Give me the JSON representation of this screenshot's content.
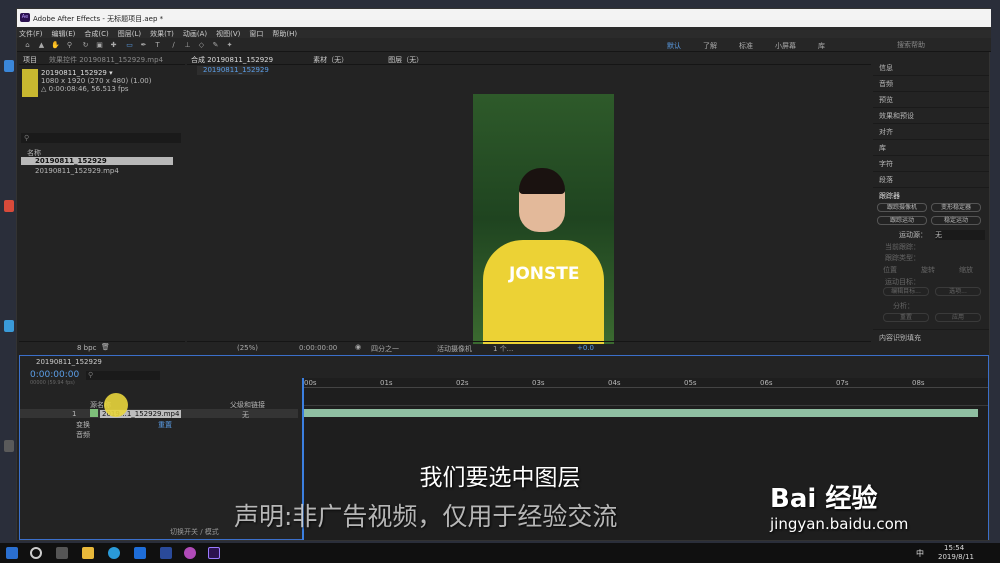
{
  "app": {
    "title": "Adobe After Effects - 无标题项目.aep *",
    "logo": "Ae"
  },
  "menu": [
    "文件(F)",
    "编辑(E)",
    "合成(C)",
    "图层(L)",
    "效果(T)",
    "动画(A)",
    "视图(V)",
    "窗口",
    "帮助(H)"
  ],
  "workspaces": [
    "默认",
    "了解",
    "标准",
    "小屏幕",
    "库"
  ],
  "workspace_search": "搜索帮助",
  "project": {
    "tabs": [
      "项目",
      "效果控件 20190811_152929.mp4"
    ],
    "item_name": "20190811_152929 ▾",
    "item_info1": "1080 x 1920 (270 x 480) (1.00)",
    "item_info2": "△ 0:00:08:46, 56.513 fps",
    "name_header": "名称",
    "items": [
      "20190811_152929",
      "20190811_152929.mp4"
    ],
    "bpc": "8 bpc"
  },
  "viewer": {
    "tabs": [
      "合成 20190811_152929",
      "素材（无）",
      "图层（无）"
    ],
    "sub_tab": "20190811_152929",
    "zoom": "(25%)",
    "timecode": "0:00:00:00",
    "quality": "四分之一",
    "camera": "活动摄像机",
    "views": "1 个...",
    "exposure": "+0.0",
    "shirt_text": "JONSTE"
  },
  "right_panel": {
    "items": [
      "信息",
      "音频",
      "预览",
      "效果和预设",
      "对齐",
      "库",
      "字符",
      "段落"
    ],
    "tracker_title": "跟踪器",
    "btns": [
      "跟踪摄像机",
      "变形稳定器",
      "跟踪运动",
      "稳定运动"
    ],
    "source_label": "运动源：",
    "source_value": "无",
    "current_track": "当前跟踪：",
    "track_type": "跟踪类型：",
    "checks": [
      "位置",
      "旋转",
      "缩放"
    ],
    "motion_target": "运动目标：",
    "edit_target": "编辑目标...",
    "options": "选项...",
    "analyze": "分析：",
    "reset": "重置",
    "apply": "应用",
    "content_fill": "内容识别填充"
  },
  "timeline": {
    "tab": "20190811_152929",
    "timecode": "0:00:00:00",
    "fps": "00000 (59.94 fps)",
    "source_header": "源名称",
    "parent_header": "父级和链接",
    "layer_num": "1",
    "layer_name": "2019…1_152929.mp4",
    "parent_value": "无",
    "transform": "变换",
    "audio": "音频",
    "reset": "重置",
    "ruler": [
      "00s",
      "01s",
      "02s",
      "03s",
      "04s",
      "05s",
      "06s",
      "07s",
      "08s"
    ],
    "toggle_label": "切换开关 / 模式"
  },
  "taskbar": {
    "time": "15:54",
    "date": "2019/8/11",
    "lang": "中"
  },
  "overlay": {
    "subtitle": "我们要选中图层",
    "disclaimer": "声明:非广告视频，仅用于经验交流",
    "baidu": "Bai 经验",
    "baidu_url": "jingyan.baidu.com"
  }
}
